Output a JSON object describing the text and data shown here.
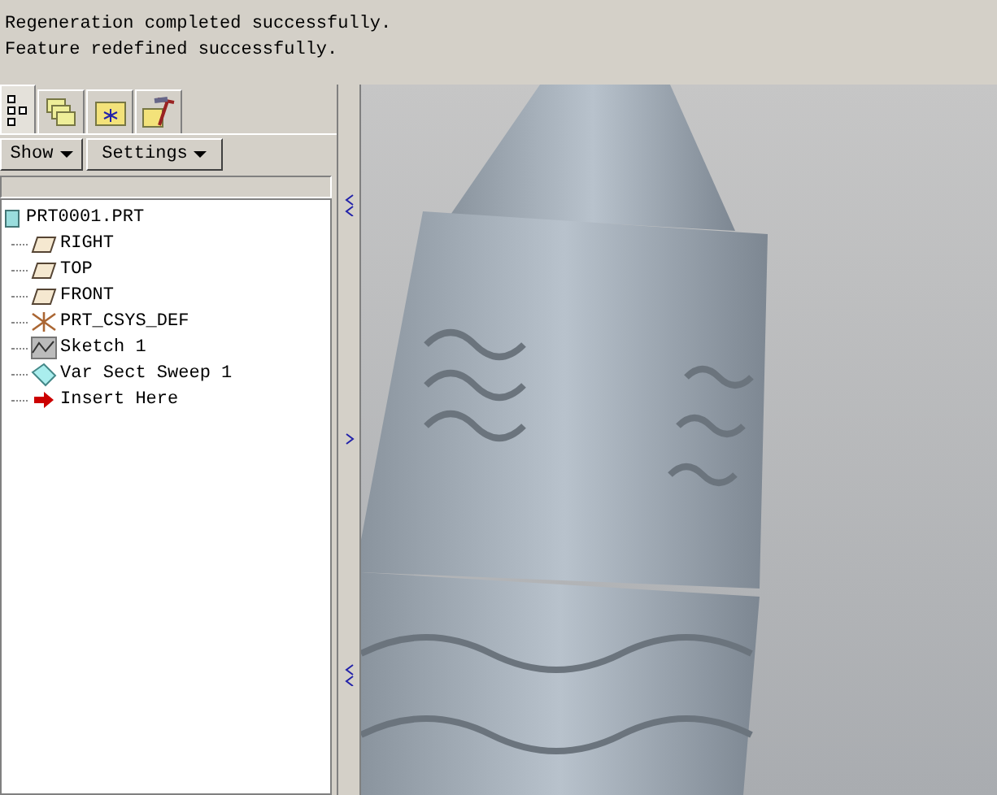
{
  "messages": [
    "Regeneration completed successfully.",
    "Feature redefined successfully."
  ],
  "tabs": [
    {
      "kind": "tree",
      "selected": true
    },
    {
      "kind": "folders",
      "selected": false
    },
    {
      "kind": "favorites",
      "selected": false
    },
    {
      "kind": "tools",
      "selected": false
    }
  ],
  "buttons": [
    {
      "label": "Show"
    },
    {
      "label": "Settings"
    }
  ],
  "tree": {
    "label": "PRT0001.PRT",
    "kind": "part",
    "children": [
      {
        "label": "RIGHT",
        "kind": "plane"
      },
      {
        "label": "TOP",
        "kind": "plane"
      },
      {
        "label": "FRONT",
        "kind": "plane"
      },
      {
        "label": "PRT_CSYS_DEF",
        "kind": "csys"
      },
      {
        "label": "Sketch 1",
        "kind": "sketch"
      },
      {
        "label": "Var Sect Sweep 1",
        "kind": "sweep"
      },
      {
        "label": "Insert Here",
        "kind": "insert"
      }
    ]
  }
}
